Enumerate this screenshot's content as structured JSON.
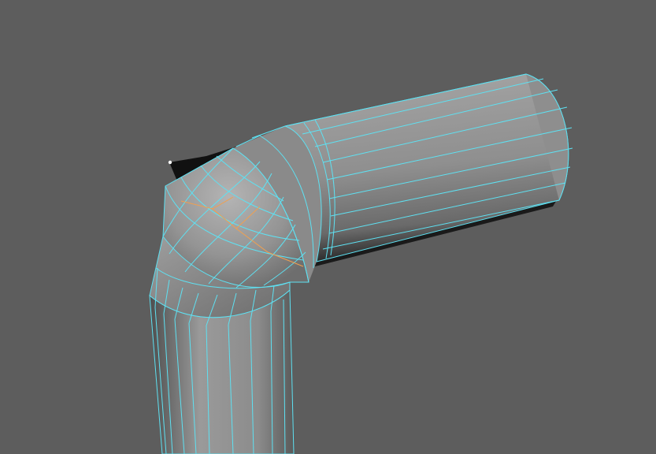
{
  "viewport": {
    "background_color": "#5d5d5d",
    "wireframe_color": "#5ee1f2",
    "selected_edge_color": "#f0a050",
    "surface_light": "#a8a8a8",
    "surface_mid": "#8a8a8a",
    "surface_dark": "#4a4a4a",
    "shadow_color": "#141414",
    "object": "bent-pipe-mesh",
    "selection_mode": "edge"
  }
}
